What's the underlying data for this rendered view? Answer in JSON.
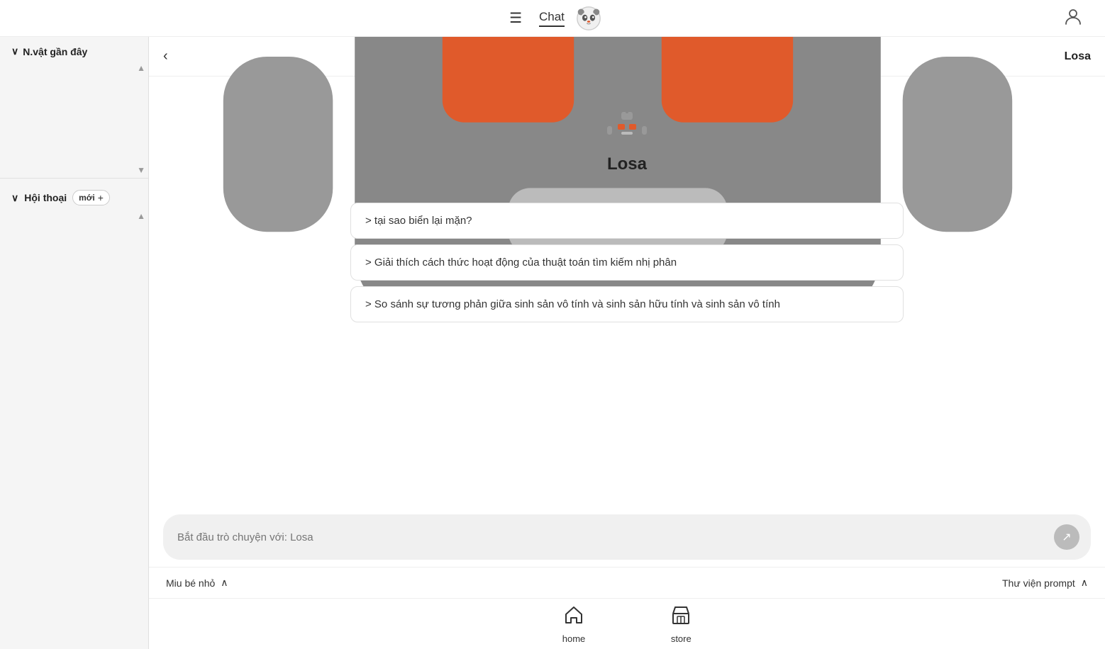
{
  "topNav": {
    "menuIcon": "☰",
    "chatLabel": "Chat",
    "userIcon": "👤"
  },
  "sidebar": {
    "nvatSection": "N.vật gần đây",
    "hoiThoaiSection": "Hội thoại",
    "newBadgeLabel": "mới",
    "newBadgePlus": "+"
  },
  "chatHeader": {
    "botName": "Losa",
    "backIcon": "‹"
  },
  "chatMain": {
    "botNameLarge": "Losa",
    "suggestions": [
      "> tại sao biển lại mặn?",
      "> Giải thích cách thức hoạt động của thuật toán tìm kiếm nhị phân",
      "> So sánh sự tương phản giữa sinh sản vô tính và sinh sản hữu tính và sinh sản vô tính"
    ]
  },
  "chatInput": {
    "placeholder": "Bắt đầu trò chuyện với: Losa",
    "sendIcon": "↗"
  },
  "bottomToolbar": {
    "leftLabel": "Miu bé nhỏ",
    "rightLabel": "Thư viện prompt",
    "chevronUp": "∧"
  },
  "bottomNav": {
    "items": [
      {
        "label": "home",
        "icon": "home"
      },
      {
        "label": "store",
        "icon": "store"
      }
    ]
  }
}
